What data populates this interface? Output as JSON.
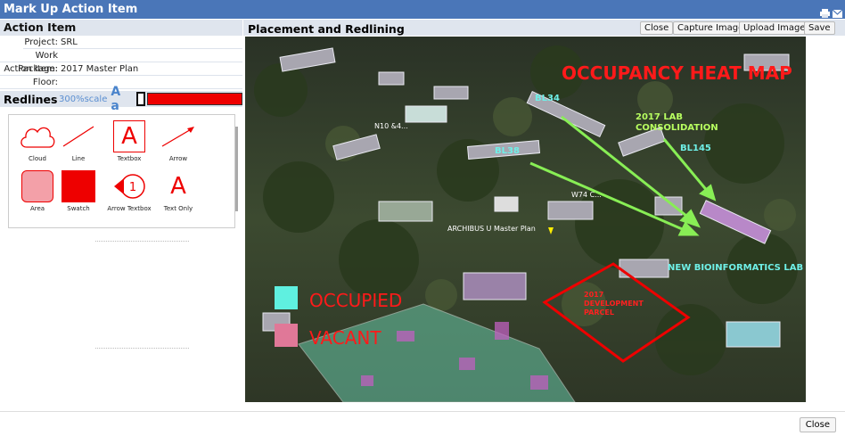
{
  "window": {
    "title": "Mark Up Action Item"
  },
  "left": {
    "section_title": "Action Item",
    "fields": [
      {
        "label": "Project:",
        "value": "SRL"
      },
      {
        "label": "Work Package:",
        "value": ""
      },
      {
        "label": "Action Item:",
        "value": "2017 Master Plan"
      },
      {
        "label": "Floor:",
        "value": ""
      }
    ],
    "redlines": {
      "title": "Redlines",
      "scale": "300%scale",
      "font_toggle": "A a",
      "color": "#ee0000"
    },
    "tools": [
      {
        "label": "Cloud",
        "icon": "cloud-icon"
      },
      {
        "label": "Line",
        "icon": "line-icon"
      },
      {
        "label": "Textbox",
        "icon": "textbox-icon",
        "glyph": "A"
      },
      {
        "label": "Arrow",
        "icon": "arrow-icon"
      },
      {
        "label": "Area",
        "icon": "area-icon"
      },
      {
        "label": "Swatch",
        "icon": "swatch-icon"
      },
      {
        "label": "Arrow Textbox",
        "icon": "arrow-textbox-icon",
        "glyph": "1"
      },
      {
        "label": "Text Only",
        "icon": "text-only-icon",
        "glyph": "A"
      }
    ]
  },
  "right": {
    "title": "Placement and Redlining",
    "buttons": {
      "close": "Close",
      "capture": "Capture Image",
      "upload": "Upload Image",
      "save": "Save"
    }
  },
  "map": {
    "heat_title": "OCCUPANCY HEAT MAP",
    "labels": {
      "bl34": "BL34",
      "bl38": "BL38",
      "bl145": "BL145",
      "lab": "2017 LAB",
      "lab2": "CONSOLIDATION",
      "w74": "W74 C... ",
      "n10": "N10 &4...",
      "archibus": "ARCHIBUS U Master Plan",
      "newlab": "NEW BIOINFORMATICS LAB",
      "dev1": "2017",
      "dev2": "DEVELOPMENT",
      "dev3": "PARCEL"
    },
    "legend": {
      "occupied": "OCCUPIED",
      "vacant": "VACANT",
      "occupied_color": "#5ff0e0",
      "vacant_color": "#e07898"
    }
  },
  "footer": {
    "close": "Close"
  }
}
